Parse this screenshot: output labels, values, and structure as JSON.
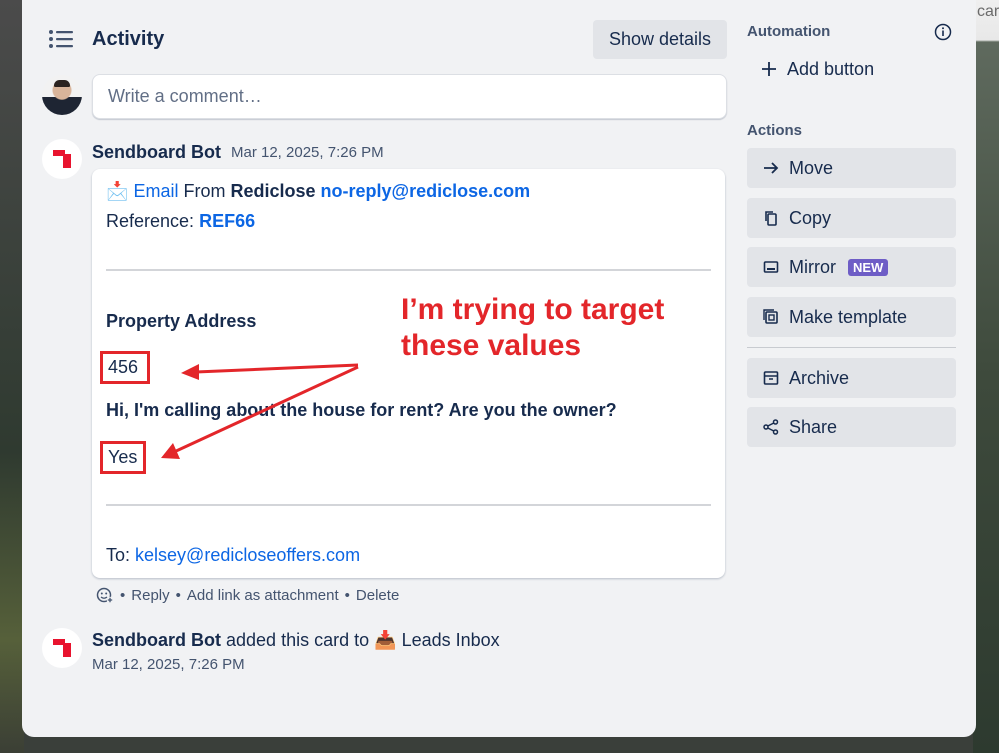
{
  "background": {
    "corner_text": "car"
  },
  "activity": {
    "title": "Activity",
    "show_details_label": "Show details",
    "comment_placeholder": "Write a comment…"
  },
  "email_entry": {
    "author": "Sendboard Bot",
    "timestamp": "Mar 12, 2025, 7:26 PM",
    "email_emoji": "📩",
    "email_label": "Email",
    "from_word": "From",
    "sender_name": "Rediclose",
    "sender_email": "no-reply@rediclose.com",
    "reference_label": "Reference:",
    "reference_value": "REF66",
    "property_address_label": "Property Address",
    "property_address_value": "456",
    "question": "Hi, I'm calling about the house for rent? Are you the owner?",
    "answer": "Yes",
    "to_label": "To:",
    "to_email": "kelsey@redicloseoffers.com"
  },
  "annotation": {
    "line1": "I’m trying to target",
    "line2": "these values"
  },
  "comment_actions": {
    "reply": "Reply",
    "add_link": "Add link as attachment",
    "delete": "Delete",
    "separator": "•"
  },
  "added_entry": {
    "author": "Sendboard Bot",
    "text": "added this card to",
    "list_emoji": "📥",
    "list_name": "Leads Inbox",
    "timestamp": "Mar 12, 2025, 7:26 PM"
  },
  "sidebar": {
    "automation_heading": "Automation",
    "add_button_label": "Add button",
    "actions_heading": "Actions",
    "actions": [
      {
        "label": "Move",
        "icon": "arrow-right-icon"
      },
      {
        "label": "Copy",
        "icon": "copy-icon"
      },
      {
        "label": "Mirror",
        "icon": "mirror-icon",
        "badge": "NEW"
      },
      {
        "label": "Make template",
        "icon": "template-icon"
      },
      {
        "label": "Archive",
        "icon": "archive-icon"
      },
      {
        "label": "Share",
        "icon": "share-icon"
      }
    ]
  },
  "colors": {
    "link": "#0c66e4",
    "annotation": "#e3262a",
    "badge": "#6e5dc6",
    "panel": "#f1f2f4"
  }
}
